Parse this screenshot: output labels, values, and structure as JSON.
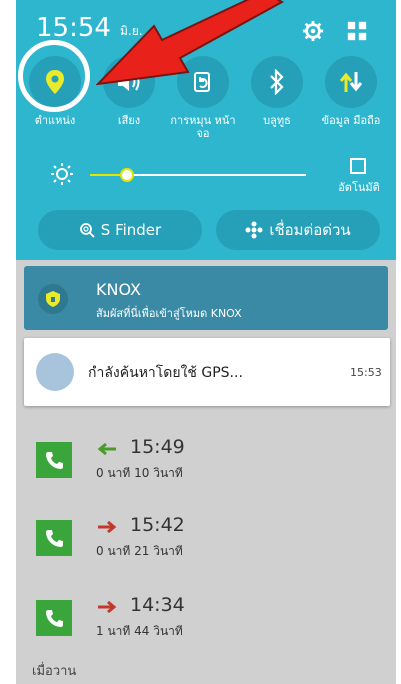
{
  "status_bar": {
    "time": "15:54",
    "date_partial": "มิ.ย.",
    "icons": [
      "settings-icon",
      "grid-icon"
    ]
  },
  "toggles": [
    {
      "label": "ตำแหน่ง",
      "icon": "location-icon"
    },
    {
      "label": "เสียง",
      "icon": "sound-icon"
    },
    {
      "label": "การหมุน หน้าจอ",
      "icon": "rotate-icon"
    },
    {
      "label": "บลูทูธ",
      "icon": "bluetooth-icon"
    },
    {
      "label": "ข้อมูล มือถือ",
      "icon": "mobile-data-icon"
    }
  ],
  "brightness": {
    "level": 0.17,
    "auto_label": "อัตโนมัติ"
  },
  "quick_buttons": {
    "finder": "S Finder",
    "connect": "เชื่อมต่อด่วน"
  },
  "notifications": {
    "knox": {
      "title": "KNOX",
      "subtitle": "สัมผัสที่นี่เพื่อเข้าสู่โหมด KNOX"
    },
    "gps": {
      "text": "กำลังค้นหาโดยใช้ GPS...",
      "time": "15:53"
    }
  },
  "calls": [
    {
      "time": "15:49",
      "duration": "0 นาที 10 วินาที",
      "direction": "incoming"
    },
    {
      "time": "15:42",
      "duration": "0 นาที 21 วินาที",
      "direction": "outgoing"
    },
    {
      "time": "14:34",
      "duration": "1 นาที 44 วินาที",
      "direction": "outgoing"
    }
  ],
  "footer": {
    "section_label": "เมื่อวาน"
  },
  "colors": {
    "panel": "#2fb6cf",
    "toggle_bg": "#26a0b8",
    "location_icon": "#e8ea2a",
    "highlight_ring": "#ffffff",
    "pointer_arrow": "#e8221a",
    "call_green": "#3aa53a",
    "arrow_in": "#4c9a2a",
    "arrow_out": "#c0392b"
  }
}
